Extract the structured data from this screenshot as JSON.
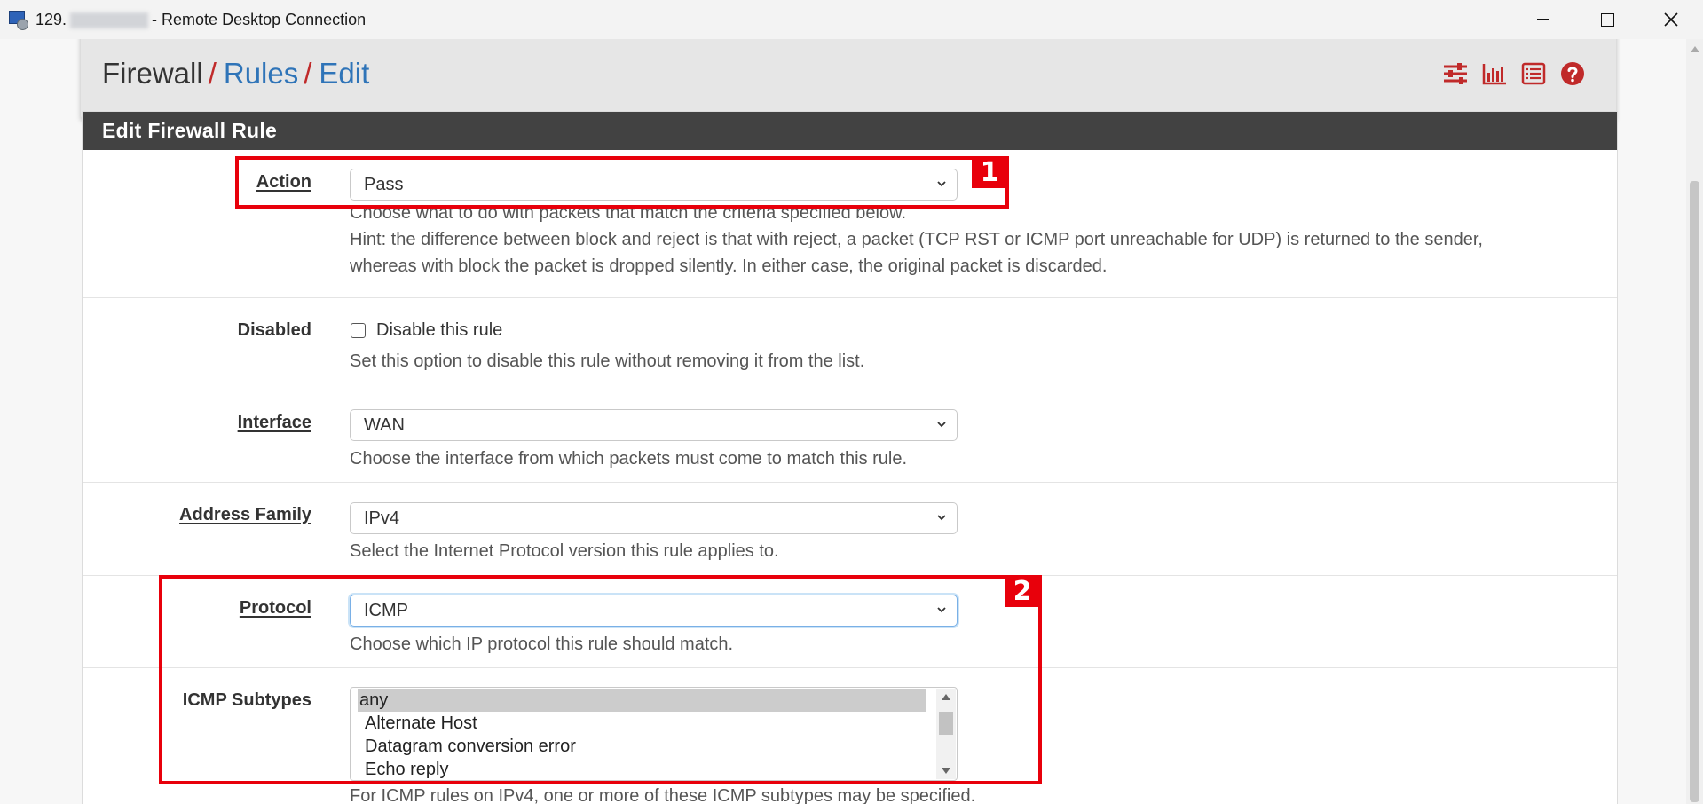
{
  "window": {
    "title_prefix": "129.",
    "title_suffix": "- Remote Desktop Connection",
    "minimize_icon": "minimize-icon",
    "maximize_icon": "maximize-icon",
    "close_icon": "close-icon"
  },
  "breadcrumb": {
    "items": [
      "Firewall",
      "Rules",
      "Edit"
    ],
    "separator": "/",
    "icons": [
      "sliders-icon",
      "bar-chart-icon",
      "list-icon",
      "help-icon"
    ]
  },
  "panel": {
    "title": "Edit Firewall Rule",
    "action": {
      "label": "Action",
      "value": "Pass",
      "help1": "Choose what to do with packets that match the criteria specified below.",
      "help2": "Hint: the difference between block and reject is that with reject, a packet (TCP RST or ICMP port unreachable for UDP) is returned to the sender,",
      "help3": "whereas with block the packet is dropped silently. In either case, the original packet is discarded."
    },
    "disabled": {
      "label": "Disabled",
      "checkbox_label": "Disable this rule",
      "help": "Set this option to disable this rule without removing it from the list."
    },
    "interface": {
      "label": "Interface",
      "value": "WAN",
      "help": "Choose the interface from which packets must come to match this rule."
    },
    "address_family": {
      "label": "Address Family",
      "value": "IPv4",
      "help": "Select the Internet Protocol version this rule applies to."
    },
    "protocol": {
      "label": "Protocol",
      "value": "ICMP",
      "help": "Choose which IP protocol this rule should match."
    },
    "icmp_subtypes": {
      "label": "ICMP Subtypes",
      "options": [
        "any",
        "Alternate Host",
        "Datagram conversion error",
        "Echo reply"
      ],
      "selected": "any",
      "help": "For ICMP rules on IPv4, one or more of these ICMP subtypes may be specified."
    }
  },
  "annotations": [
    "1",
    "2"
  ],
  "colors": {
    "accent_red": "#e8000b",
    "link_blue": "#2f74b8",
    "panel_header": "#424242"
  }
}
